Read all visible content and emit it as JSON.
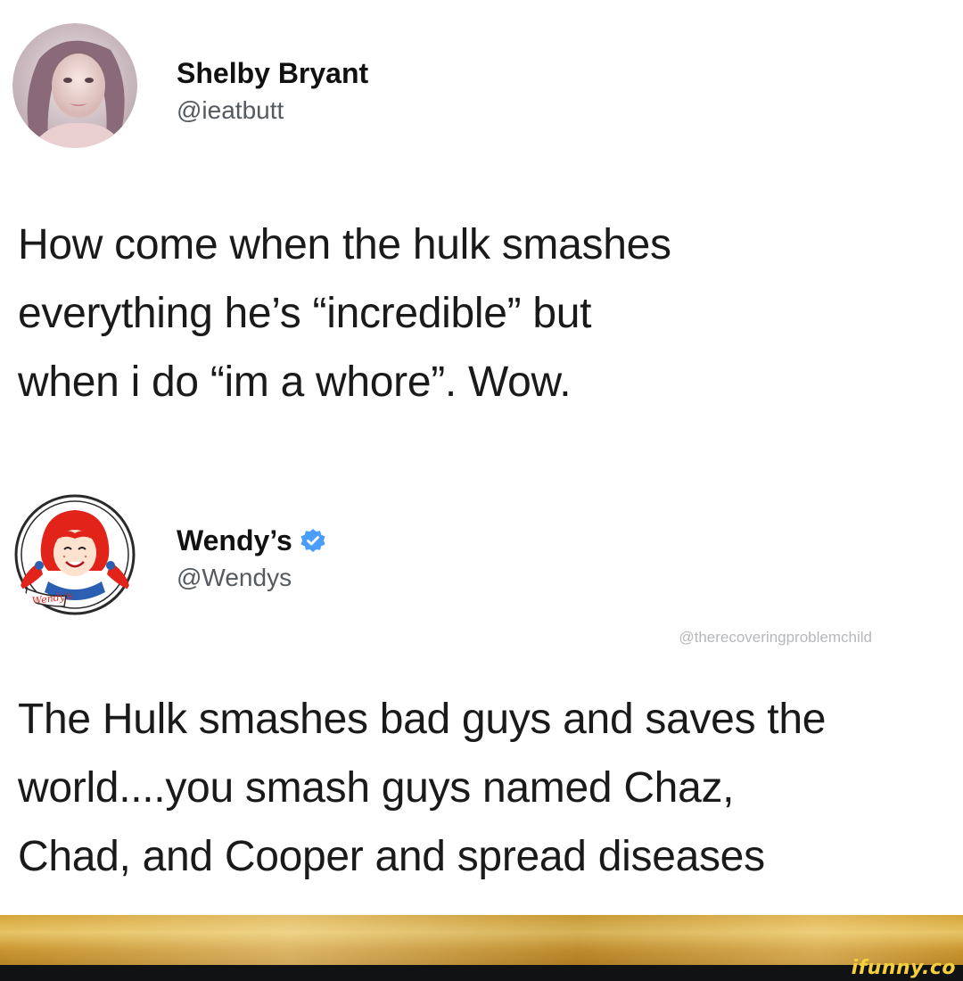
{
  "tweet1": {
    "display_name": "Shelby Bryant",
    "handle": "@ieatbutt",
    "text": "How come when the hulk smashes\neverything he’s “incredible” but\nwhen i do “im a whore”. Wow."
  },
  "tweet2": {
    "display_name": "Wendy’s",
    "handle": "@Wendys",
    "verified": true,
    "text": "The Hulk smashes bad guys and saves the\nworld....you smash guys named Chaz,\nChad, and Cooper and spread diseases"
  },
  "watermark": {
    "handle": "@therecoveringproblemchild",
    "site": "ifunny.co"
  },
  "colors": {
    "verified_blue": "#4a9df8",
    "wendys_red": "#e2231a",
    "ifunny_yellow": "#f6d03a"
  },
  "icons": {
    "verified": "verified-badge-icon",
    "avatar1": "user-avatar",
    "avatar2": "wendys-logo"
  }
}
